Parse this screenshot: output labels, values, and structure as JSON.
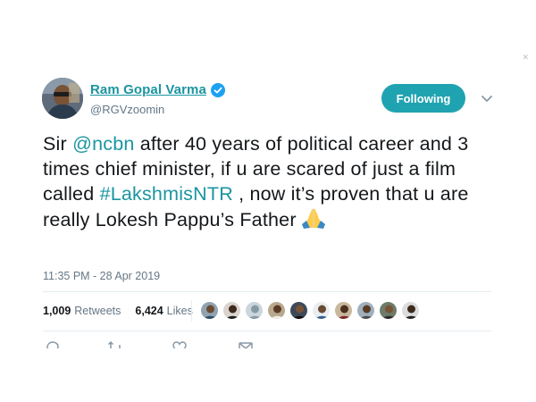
{
  "user": {
    "display_name": "Ram Gopal Varma",
    "handle": "@RGVzoomin",
    "avatar_icon": "user-avatar-photo",
    "verified_icon": "verified-badge-icon"
  },
  "follow_button": {
    "label": "Following"
  },
  "menu": {
    "icon": "chevron-down-icon"
  },
  "tweet": {
    "part1": "Sir ",
    "mention": "@ncbn",
    "part2": " after 40 years of political career and 3 times chief minister, if u are scared of just a film called ",
    "hashtag": "#LakshmisNTR",
    "part3": " , now it’s proven that u are really Lokesh Pappu’s Father",
    "emoji_icon": "folded-hands-emoji"
  },
  "timestamp": "11:35 PM - 28 Apr 2019",
  "stats": {
    "retweets_count": "1,009",
    "retweets_label": "Retweets",
    "likes_count": "6,424",
    "likes_label": "Likes"
  },
  "likers": {
    "count_shown": 10
  },
  "actions": {
    "icons": [
      "reply-icon",
      "retweet-icon",
      "like-icon",
      "message-icon"
    ]
  },
  "colors": {
    "accent": "#1b95a0",
    "follow_bg": "#20a3b0",
    "text": "#14171a",
    "muted": "#657786",
    "divider": "#e6ecf0",
    "verified": "#1da1f2"
  }
}
